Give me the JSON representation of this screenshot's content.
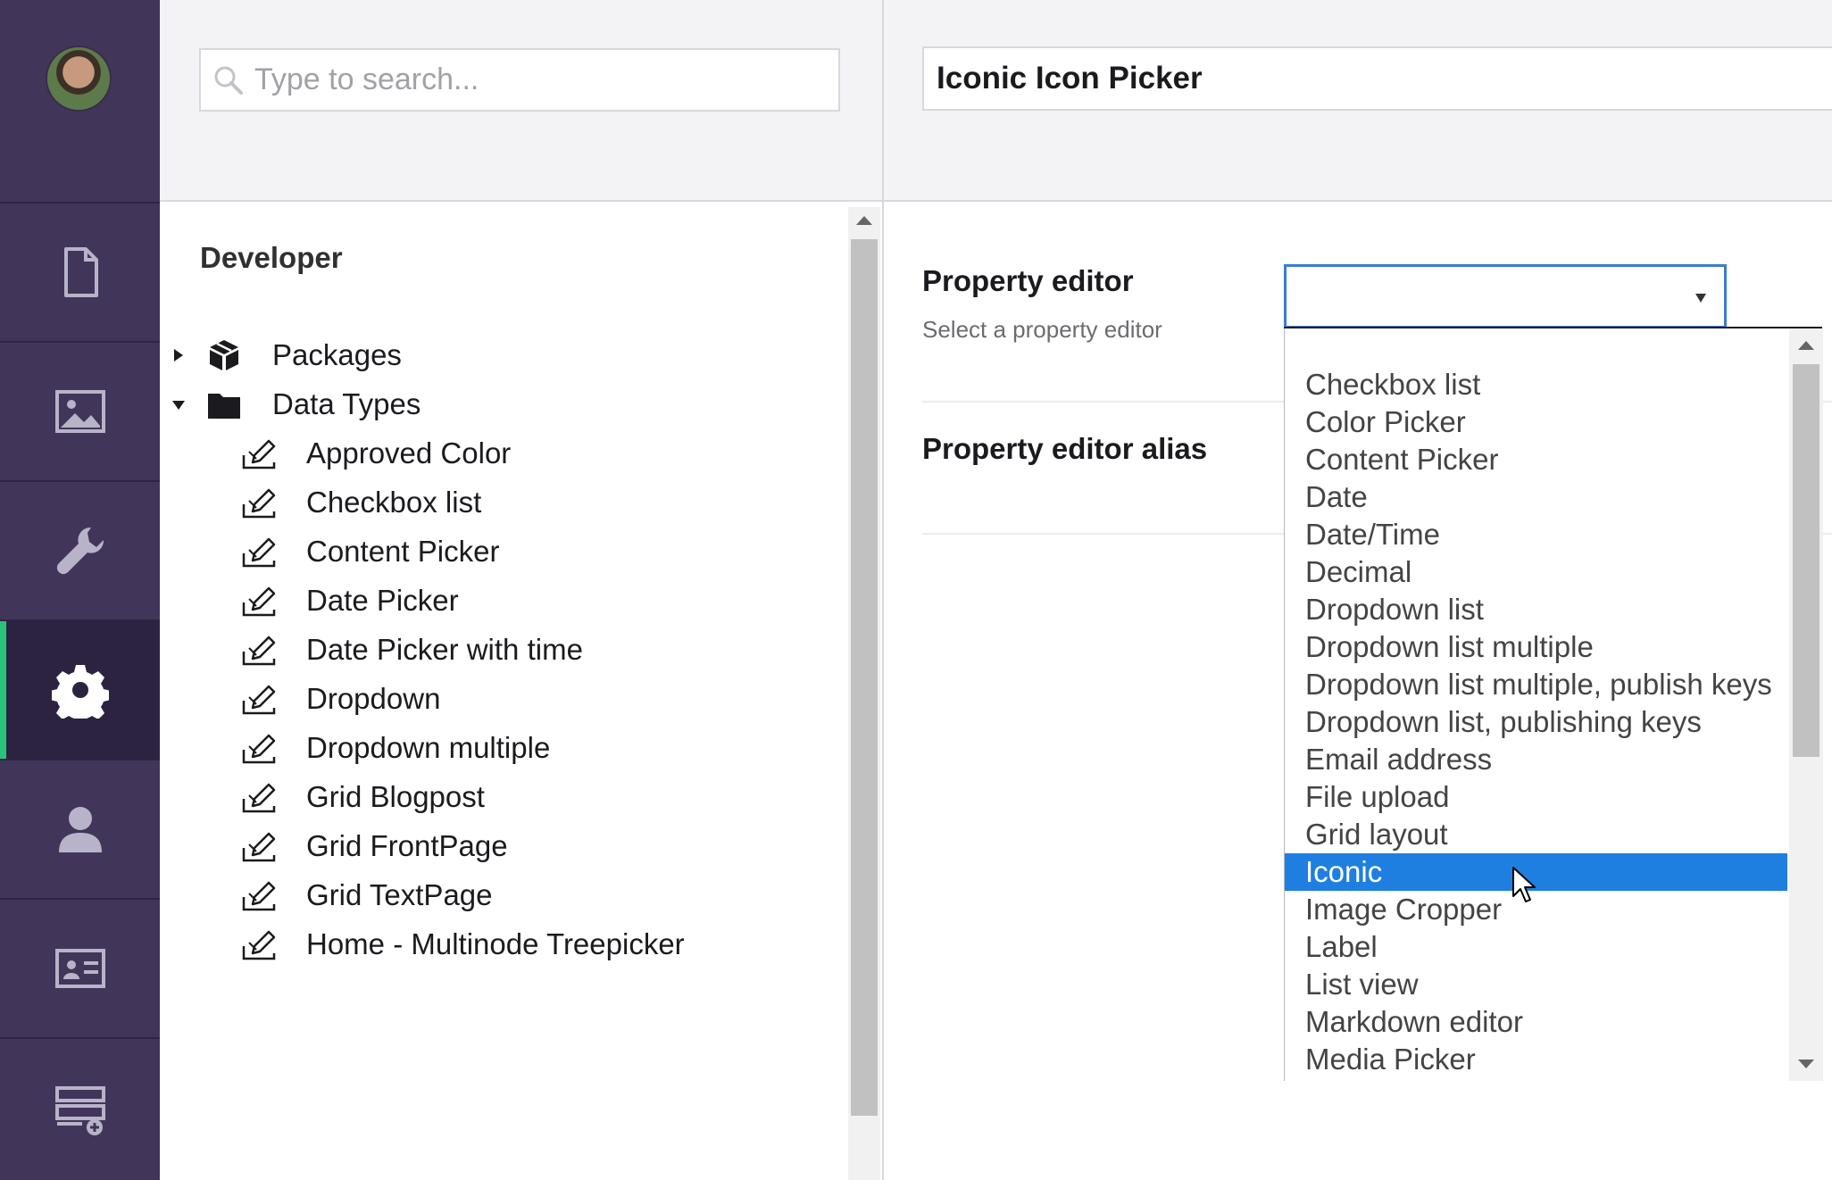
{
  "rail": {
    "avatar_alt": "User avatar",
    "sections": [
      {
        "icon": "document-icon",
        "active": false
      },
      {
        "icon": "image-icon",
        "active": false
      },
      {
        "icon": "wrench-icon",
        "active": false
      },
      {
        "icon": "gear-icon",
        "active": true
      },
      {
        "icon": "user-icon",
        "active": false
      },
      {
        "icon": "id-card-icon",
        "active": false
      },
      {
        "icon": "form-add-icon",
        "active": false
      }
    ],
    "active_accent": "#2bc37c"
  },
  "search": {
    "placeholder": "Type to search...",
    "value": ""
  },
  "tree": {
    "title": "Developer",
    "nodes": [
      {
        "label": "Packages",
        "icon": "package-icon",
        "expanded": false
      },
      {
        "label": "Data Types",
        "icon": "folder-icon",
        "expanded": true
      }
    ],
    "children": [
      "Approved Color",
      "Checkbox list",
      "Content Picker",
      "Date Picker",
      "Date Picker with time",
      "Dropdown",
      "Dropdown multiple",
      "Grid Blogpost",
      "Grid FrontPage",
      "Grid TextPage",
      "Home - Multinode Treepicker"
    ]
  },
  "editor": {
    "name": "Iconic Icon Picker",
    "property_editor": {
      "label": "Property editor",
      "description": "Select a property editor",
      "selected_value": ""
    },
    "property_editor_alias": {
      "label": "Property editor alias"
    }
  },
  "dropdown": {
    "options": [
      "Checkbox list",
      "Color Picker",
      "Content Picker",
      "Date",
      "Date/Time",
      "Decimal",
      "Dropdown list",
      "Dropdown list multiple",
      "Dropdown list multiple, publish keys",
      "Dropdown list, publishing keys",
      "Email address",
      "File upload",
      "Grid layout",
      "Iconic",
      "Image Cropper",
      "Label",
      "List view",
      "Markdown editor",
      "Media Picker"
    ],
    "highlighted": "Iconic",
    "highlight_color": "#1e7fe0"
  }
}
